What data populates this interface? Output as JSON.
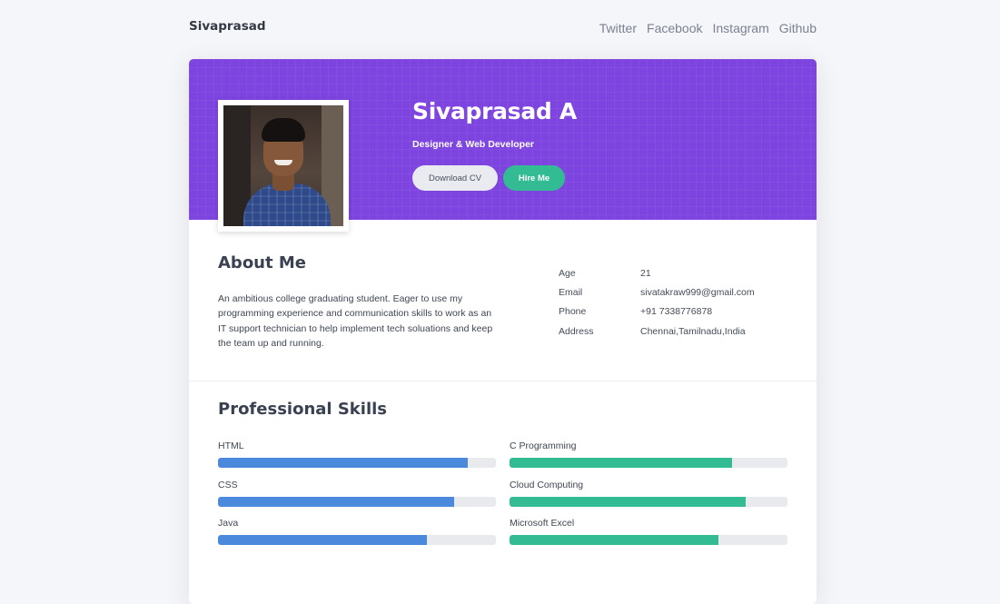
{
  "nav": {
    "brand": "Sivaprasad",
    "links": [
      "Twitter",
      "Facebook",
      "Instagram",
      "Github"
    ]
  },
  "hero": {
    "name": "Sivaprasad A",
    "role": "Designer & Web Developer",
    "download_cv_label": "Download CV",
    "hire_me_label": "Hire Me"
  },
  "about": {
    "title": "About Me",
    "text": "An ambitious college graduating student. Eager to use my programming experience and communication skills to work as an IT support technician to help implement tech soluations and keep the team up and running.",
    "info": [
      {
        "key": "Age",
        "value": "21"
      },
      {
        "key": "Email",
        "value": "sivatakraw999@gmail.com"
      },
      {
        "key": "Phone",
        "value": "+91 7338776878"
      },
      {
        "key": "Address",
        "value": "Chennai,Tamilnadu,India"
      }
    ]
  },
  "skills": {
    "title": "Professional Skills",
    "left": [
      {
        "name": "HTML",
        "level": 0.9
      },
      {
        "name": "CSS",
        "level": 0.85
      },
      {
        "name": "Java",
        "level": 0.75
      }
    ],
    "right": [
      {
        "name": "C Programming",
        "level": 0.8
      },
      {
        "name": "Cloud Computing",
        "level": 0.85
      },
      {
        "name": "Microsoft Excel",
        "level": 0.75
      }
    ]
  },
  "colors": {
    "hero_bg": "#7e44df",
    "hire_button": "#33bc93",
    "skill_left": "#4a89dc",
    "skill_right": "#33bc93",
    "track": "#e8eaee"
  }
}
